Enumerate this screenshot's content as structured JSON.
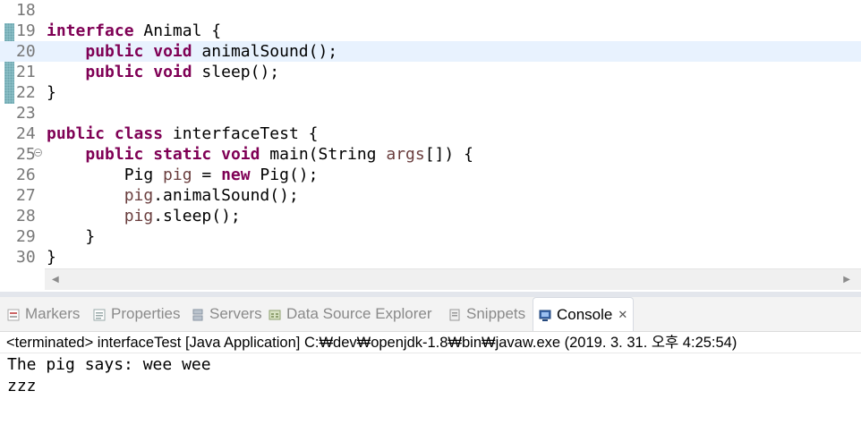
{
  "editor": {
    "lines": [
      {
        "num": "18",
        "segments": []
      },
      {
        "num": "19",
        "segments": [
          {
            "t": "interface",
            "c": "kw"
          },
          {
            "t": " Animal {",
            "c": ""
          }
        ]
      },
      {
        "num": "20",
        "segments": [
          {
            "t": "    ",
            "c": ""
          },
          {
            "t": "public",
            "c": "kw"
          },
          {
            "t": " ",
            "c": ""
          },
          {
            "t": "void",
            "c": "kw"
          },
          {
            "t": " animalSound();",
            "c": ""
          }
        ],
        "highlight": true
      },
      {
        "num": "21",
        "segments": [
          {
            "t": "    ",
            "c": ""
          },
          {
            "t": "public",
            "c": "kw"
          },
          {
            "t": " ",
            "c": ""
          },
          {
            "t": "void",
            "c": "kw"
          },
          {
            "t": " sleep();",
            "c": ""
          }
        ]
      },
      {
        "num": "22",
        "segments": [
          {
            "t": "}",
            "c": ""
          }
        ]
      },
      {
        "num": "23",
        "segments": []
      },
      {
        "num": "24",
        "segments": [
          {
            "t": "public",
            "c": "kw"
          },
          {
            "t": " ",
            "c": ""
          },
          {
            "t": "class",
            "c": "kw"
          },
          {
            "t": " interfaceTest {",
            "c": ""
          }
        ]
      },
      {
        "num": "25",
        "segments": [
          {
            "t": "    ",
            "c": ""
          },
          {
            "t": "public",
            "c": "kw"
          },
          {
            "t": " ",
            "c": ""
          },
          {
            "t": "static",
            "c": "kw"
          },
          {
            "t": " ",
            "c": ""
          },
          {
            "t": "void",
            "c": "kw"
          },
          {
            "t": " main(String ",
            "c": ""
          },
          {
            "t": "args",
            "c": "lv"
          },
          {
            "t": "[]) {",
            "c": ""
          }
        ],
        "fold": true
      },
      {
        "num": "26",
        "segments": [
          {
            "t": "        Pig ",
            "c": ""
          },
          {
            "t": "pig",
            "c": "lv"
          },
          {
            "t": " = ",
            "c": ""
          },
          {
            "t": "new",
            "c": "kw"
          },
          {
            "t": " Pig();",
            "c": ""
          }
        ]
      },
      {
        "num": "27",
        "segments": [
          {
            "t": "        ",
            "c": ""
          },
          {
            "t": "pig",
            "c": "lv"
          },
          {
            "t": ".animalSound();",
            "c": ""
          }
        ]
      },
      {
        "num": "28",
        "segments": [
          {
            "t": "        ",
            "c": ""
          },
          {
            "t": "pig",
            "c": "lv"
          },
          {
            "t": ".sleep();",
            "c": ""
          }
        ]
      },
      {
        "num": "29",
        "segments": [
          {
            "t": "    }",
            "c": ""
          }
        ]
      },
      {
        "num": "30",
        "segments": [
          {
            "t": "}",
            "c": ""
          }
        ]
      }
    ],
    "scroll_left": "◀",
    "scroll_right": "▶"
  },
  "views": {
    "tabs": [
      {
        "label": "Markers",
        "icon": "markers-icon"
      },
      {
        "label": "Properties",
        "icon": "properties-icon"
      },
      {
        "label": "Servers",
        "icon": "servers-icon"
      },
      {
        "label": "Data Source Explorer",
        "icon": "data-source-icon"
      },
      {
        "label": "Snippets",
        "icon": "snippets-icon"
      },
      {
        "label": "Console",
        "icon": "console-icon",
        "active": true,
        "close": "✕"
      }
    ]
  },
  "console": {
    "header": "<terminated> interfaceTest [Java Application] C:₩dev₩openjdk-1.8₩bin₩javaw.exe (2019. 3. 31. 오후 4:25:54)",
    "output": [
      "The pig says: wee wee",
      "zzz"
    ]
  },
  "colors": {
    "keyword": "#7f0055",
    "local_var": "#6a3e3e",
    "line_number": "#787878",
    "highlight": "#e8f2fe"
  }
}
